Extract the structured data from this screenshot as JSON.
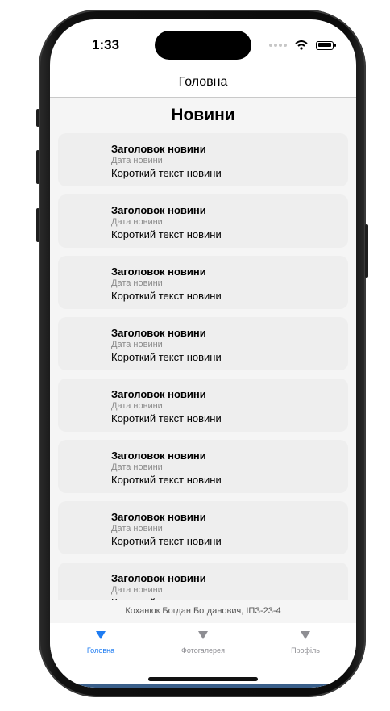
{
  "status_bar": {
    "time": "1:33"
  },
  "navbar": {
    "title": "Головна"
  },
  "page": {
    "title": "Новини"
  },
  "news": [
    {
      "title": "Заголовок новини",
      "date": "Дата новини",
      "text": "Короткий текст новини"
    },
    {
      "title": "Заголовок новини",
      "date": "Дата новини",
      "text": "Короткий текст новини"
    },
    {
      "title": "Заголовок новини",
      "date": "Дата новини",
      "text": "Короткий текст новини"
    },
    {
      "title": "Заголовок новини",
      "date": "Дата новини",
      "text": "Короткий текст новини"
    },
    {
      "title": "Заголовок новини",
      "date": "Дата новини",
      "text": "Короткий текст новини"
    },
    {
      "title": "Заголовок новини",
      "date": "Дата новини",
      "text": "Короткий текст новини"
    },
    {
      "title": "Заголовок новини",
      "date": "Дата новини",
      "text": "Короткий текст новини"
    },
    {
      "title": "Заголовок новини",
      "date": "Дата новини",
      "text": "Короткий текст новини"
    }
  ],
  "footer": {
    "credit": "Коханюк Богдан Богданович, ІПЗ-23-4"
  },
  "tabs": [
    {
      "label": "Головна",
      "icon": "triangle-down-icon",
      "active": true
    },
    {
      "label": "Фотогалерея",
      "icon": "triangle-down-icon",
      "active": false
    },
    {
      "label": "Профіль",
      "icon": "triangle-down-icon",
      "active": false
    }
  ],
  "colors": {
    "accent": "#1e7cf2",
    "inactive": "#8e8e93",
    "card": "#eeeeee",
    "background": "#f5f5f5"
  }
}
